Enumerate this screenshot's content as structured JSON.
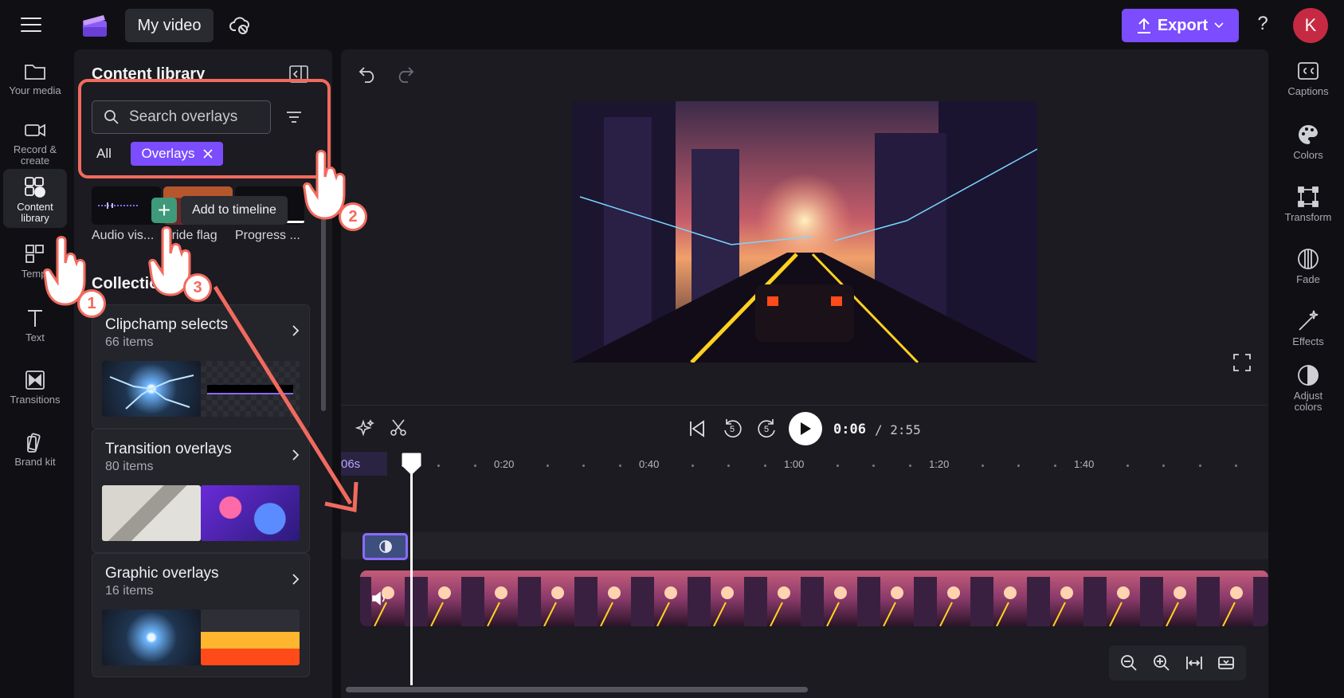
{
  "header": {
    "project_title": "My video",
    "export_label": "Export",
    "help_label": "?",
    "avatar_initial": "K"
  },
  "left_rail": {
    "items": [
      {
        "label_line1": "Your media",
        "label_line2": ""
      },
      {
        "label_line1": "Record &",
        "label_line2": "create"
      },
      {
        "label_line1": "Content",
        "label_line2": "library"
      },
      {
        "label_line1": "Templ",
        "label_line2": ""
      },
      {
        "label_line1": "Text",
        "label_line2": ""
      },
      {
        "label_line1": "Transitions",
        "label_line2": ""
      },
      {
        "label_line1": "Brand kit",
        "label_line2": ""
      }
    ],
    "active": "Content library"
  },
  "library": {
    "title": "Content library",
    "search_placeholder": "Search overlays",
    "chip_all": "All",
    "chip_overlays": "Overlays",
    "items": [
      {
        "label": "Audio vis..."
      },
      {
        "label": "Pride flag"
      },
      {
        "label": "Progress ..."
      }
    ],
    "add_tooltip": "Add to timeline",
    "collections_title": "Collectio",
    "collections": [
      {
        "name": "Clipchamp selects",
        "count": "66 items"
      },
      {
        "name": "Transition overlays",
        "count": "80 items"
      },
      {
        "name": "Graphic overlays",
        "count": "16 items"
      }
    ]
  },
  "player": {
    "current_time": "0:06",
    "total_time": "/ 2:55",
    "rewind_seconds": "5",
    "forward_seconds": "5"
  },
  "timeline": {
    "played_label": "06s",
    "ruler_labels": [
      "0:20",
      "0:40",
      "1:00",
      "1:20",
      "1:40"
    ]
  },
  "right_rail": {
    "items": [
      {
        "label_line1": "Captions",
        "label_line2": ""
      },
      {
        "label_line1": "Colors",
        "label_line2": ""
      },
      {
        "label_line1": "Transform",
        "label_line2": ""
      },
      {
        "label_line1": "Fade",
        "label_line2": ""
      },
      {
        "label_line1": "Effects",
        "label_line2": ""
      },
      {
        "label_line1": "Adjust",
        "label_line2": "colors"
      }
    ]
  },
  "annotations": {
    "step1": "1",
    "step2": "2",
    "step3": "3",
    "accent_color": "#f26a5e"
  },
  "colors": {
    "accent": "#7b4dff",
    "add_button": "#3e9a7a",
    "avatar": "#c62a43"
  }
}
